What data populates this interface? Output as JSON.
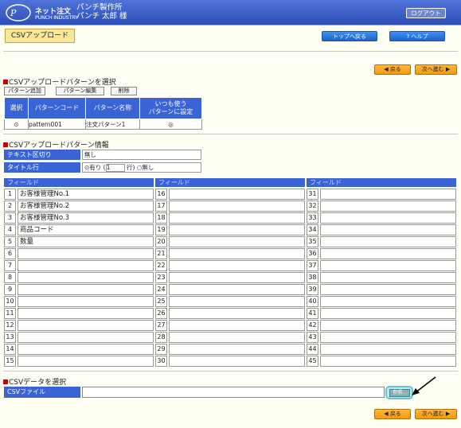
{
  "header": {
    "logo_line1": "ネット注文",
    "logo_line2": "PUNCH INDUSTRY",
    "company": "パンチ製作所",
    "user": "パンチ  太郎 様",
    "logout": "ログアウト"
  },
  "page_title": "CSVアップロード",
  "toolbar": {
    "top": "トップへ戻る",
    "help": "ヘルプ"
  },
  "nav": {
    "back": "戻る",
    "next": "次へ進む"
  },
  "pattern_section": {
    "title": "CSVアップロードパターンを選択",
    "add": "パターン追加",
    "edit": "パターン編集",
    "delete": "削除",
    "headers": {
      "select": "選択",
      "code": "パターンコード",
      "name": "パターン名称",
      "default_l1": "いつも使う",
      "default_l2": "パターンに設定"
    },
    "row": {
      "code": "pattern001",
      "name": "注文パターン1"
    }
  },
  "info_section": {
    "title": "CSVアップロードパターン情報",
    "delimiter_label": "テキスト区切り",
    "delimiter_value": "無し",
    "title_row_label": "タイトル行",
    "yes": "有り",
    "row_value": "1",
    "row_unit": "行)",
    "no": "無し"
  },
  "fields": {
    "header": "フィールド",
    "col1": [
      {
        "n": "1",
        "v": "お客様管理No.1"
      },
      {
        "n": "2",
        "v": "お客様管理No.2"
      },
      {
        "n": "3",
        "v": "お客様管理No.3"
      },
      {
        "n": "4",
        "v": "商品コード"
      },
      {
        "n": "5",
        "v": "数量"
      },
      {
        "n": "6",
        "v": ""
      },
      {
        "n": "7",
        "v": ""
      },
      {
        "n": "8",
        "v": ""
      },
      {
        "n": "9",
        "v": ""
      },
      {
        "n": "10",
        "v": ""
      },
      {
        "n": "11",
        "v": ""
      },
      {
        "n": "12",
        "v": ""
      },
      {
        "n": "13",
        "v": ""
      },
      {
        "n": "14",
        "v": ""
      },
      {
        "n": "15",
        "v": ""
      }
    ],
    "col2": [
      "16",
      "17",
      "18",
      "19",
      "20",
      "21",
      "22",
      "23",
      "24",
      "25",
      "26",
      "27",
      "28",
      "29",
      "30"
    ],
    "col3": [
      "31",
      "32",
      "33",
      "34",
      "35",
      "36",
      "37",
      "38",
      "39",
      "40",
      "41",
      "42",
      "43",
      "44",
      "45"
    ]
  },
  "file_section": {
    "title": "CSVデータを選択",
    "label": "CSVファイル",
    "browse": "参照..."
  }
}
